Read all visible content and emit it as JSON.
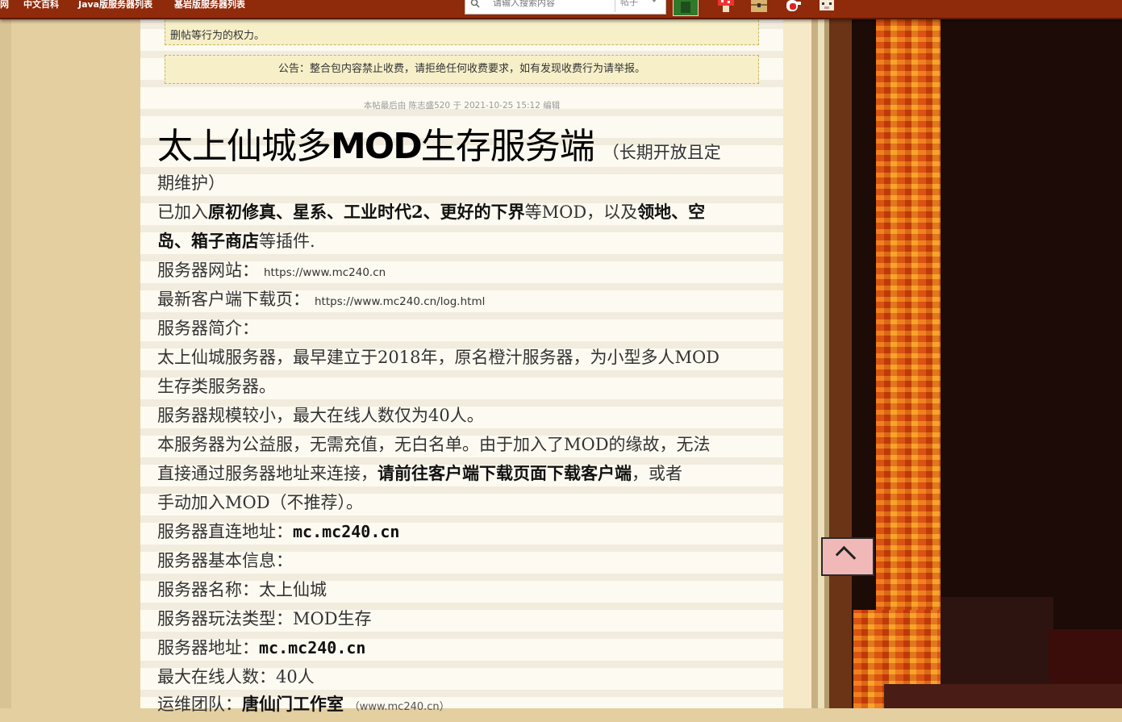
{
  "topbar": {
    "links": [
      "网",
      "中文百科",
      "Java版服务器列表",
      "基岩版服务器列表"
    ],
    "search_placeholder": "请输入搜索内容",
    "search_type": "帖子"
  },
  "notices": {
    "top_fragment": "删帖等行为的权力。",
    "announcement": "公告：整合包内容禁止收费，请拒绝任何收费要求，如有发现收费行为请举报。"
  },
  "post": {
    "edit_note": "本帖最后由 陈志盛520 于 2021-10-25 15:12 编辑",
    "title_part1": "太上仙城多",
    "title_part2": "MOD",
    "title_part3": "生存服务端",
    "title_suffix": "（长期开放且定",
    "title_suffix2": "期维护）",
    "intro_a": "已加入",
    "intro_b": "原初修真、星系、工业时代2、更好的下界",
    "intro_c": "等MOD，以及",
    "intro_d": "领地、空",
    "intro_e": "岛、箱子商店",
    "intro_f": "等插件.",
    "website_label": "服务器网站：",
    "website_url": "https://www.mc240.cn",
    "download_label": "最新客户端下载页：",
    "download_url": "https://www.mc240.cn/log.html",
    "summary_label": "服务器简介：",
    "summary_1": "太上仙城服务器，最早建立于2018年，原名橙汁服务器，为小型多人MOD",
    "summary_2": "生存类服务器。",
    "summary_3": "服务器规模较小，最大在线人数仅为40人。",
    "summary_4": "本服务器为公益服，无需充值，无白名单。由于加入了MOD的缘故，无法",
    "summary_5a": "直接通过服务器地址来连接，",
    "summary_5b": "请前往客户端下载页面下载客户端",
    "summary_5c": "，或者",
    "summary_6": "手动加入MOD（不推荐）。",
    "direct_label": "服务器直连地址：",
    "direct_addr": "mc.mc240.cn",
    "basic_label": "服务器基本信息：",
    "name_label": "服务器名称：",
    "name_value": "太上仙城",
    "type_label": "服务器玩法类型：",
    "type_value": "MOD生存",
    "addr_label": "服务器地址：",
    "addr_value": "mc.mc240.cn",
    "max_label": "最大在线人数：",
    "max_value": "40人",
    "team_label": "运维团队：",
    "team_value": "唐仙门工作室",
    "team_url": "（www.mc240.cn）"
  }
}
